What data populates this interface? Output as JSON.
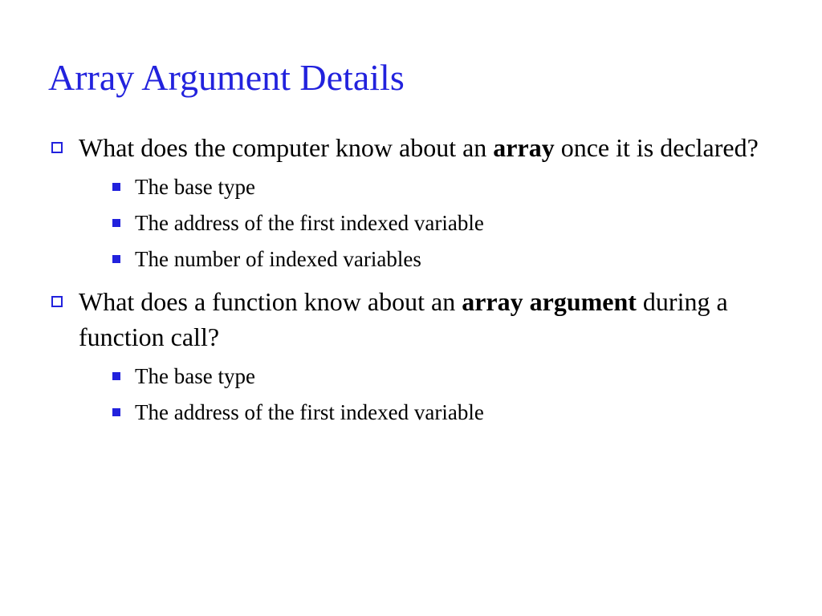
{
  "title": "Array Argument Details",
  "bullets": [
    {
      "prefix": "What does the computer know about an ",
      "bold": "array",
      "suffix": " once it is declared?",
      "sub": [
        "The base type",
        "The address of the first indexed variable",
        "The number of indexed variables"
      ]
    },
    {
      "prefix": "What does a function know about an ",
      "bold": "array argument",
      "suffix": " during a function call?",
      "sub": [
        "The base type",
        "The address of the first indexed variable"
      ]
    }
  ]
}
